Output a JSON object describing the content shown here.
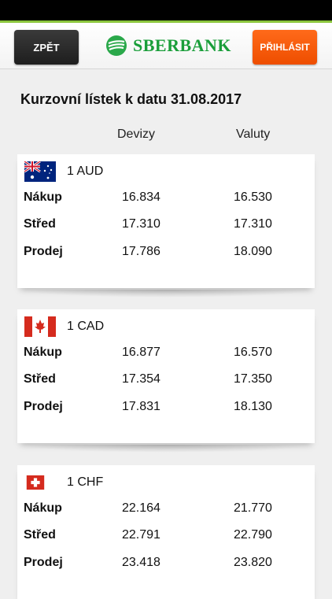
{
  "nav": {
    "back_label": "ZPĚT",
    "login_label": "PŘIHLÁSIT",
    "logo_text": "SBERBANK"
  },
  "page": {
    "title": "Kurzovní lístek k datu 31.08.2017",
    "col_devizy": "Devizy",
    "col_valuty": "Valuty"
  },
  "rates": [
    {
      "currency": "1 AUD",
      "flag": "australia-flag-icon",
      "rows": [
        {
          "label": "Nákup",
          "devizy": "16.834",
          "valuty": "16.530"
        },
        {
          "label": "Střed",
          "devizy": "17.310",
          "valuty": "17.310"
        },
        {
          "label": "Prodej",
          "devizy": "17.786",
          "valuty": "18.090"
        }
      ]
    },
    {
      "currency": "1 CAD",
      "flag": "canada-flag-icon",
      "rows": [
        {
          "label": "Nákup",
          "devizy": "16.877",
          "valuty": "16.570"
        },
        {
          "label": "Střed",
          "devizy": "17.354",
          "valuty": "17.350"
        },
        {
          "label": "Prodej",
          "devizy": "17.831",
          "valuty": "18.130"
        }
      ]
    },
    {
      "currency": "1 CHF",
      "flag": "switzerland-flag-icon",
      "rows": [
        {
          "label": "Nákup",
          "devizy": "22.164",
          "valuty": "21.770"
        },
        {
          "label": "Střed",
          "devizy": "22.791",
          "valuty": "22.790"
        },
        {
          "label": "Prodej",
          "devizy": "23.418",
          "valuty": "23.820"
        }
      ]
    }
  ],
  "colors": {
    "brand_green": "#1a9e3a",
    "accent_orange": "#ee4e00",
    "status_line": "#8cc63e"
  }
}
